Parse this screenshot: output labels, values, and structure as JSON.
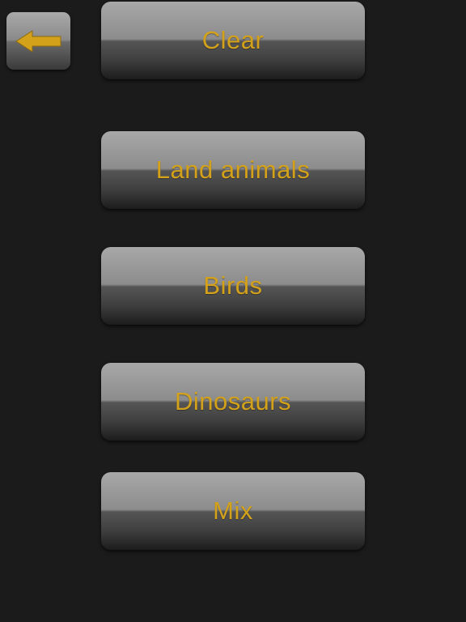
{
  "back": {
    "icon": "arrow-left-icon",
    "color": "#d4a21a"
  },
  "menu": {
    "items": [
      {
        "label": "Clear"
      },
      {
        "label": "Land animals"
      },
      {
        "label": "Birds"
      },
      {
        "label": "Dinosaurs"
      },
      {
        "label": "Mix"
      }
    ]
  },
  "colors": {
    "background": "#1b1b1b",
    "label": "#d4a21a"
  }
}
